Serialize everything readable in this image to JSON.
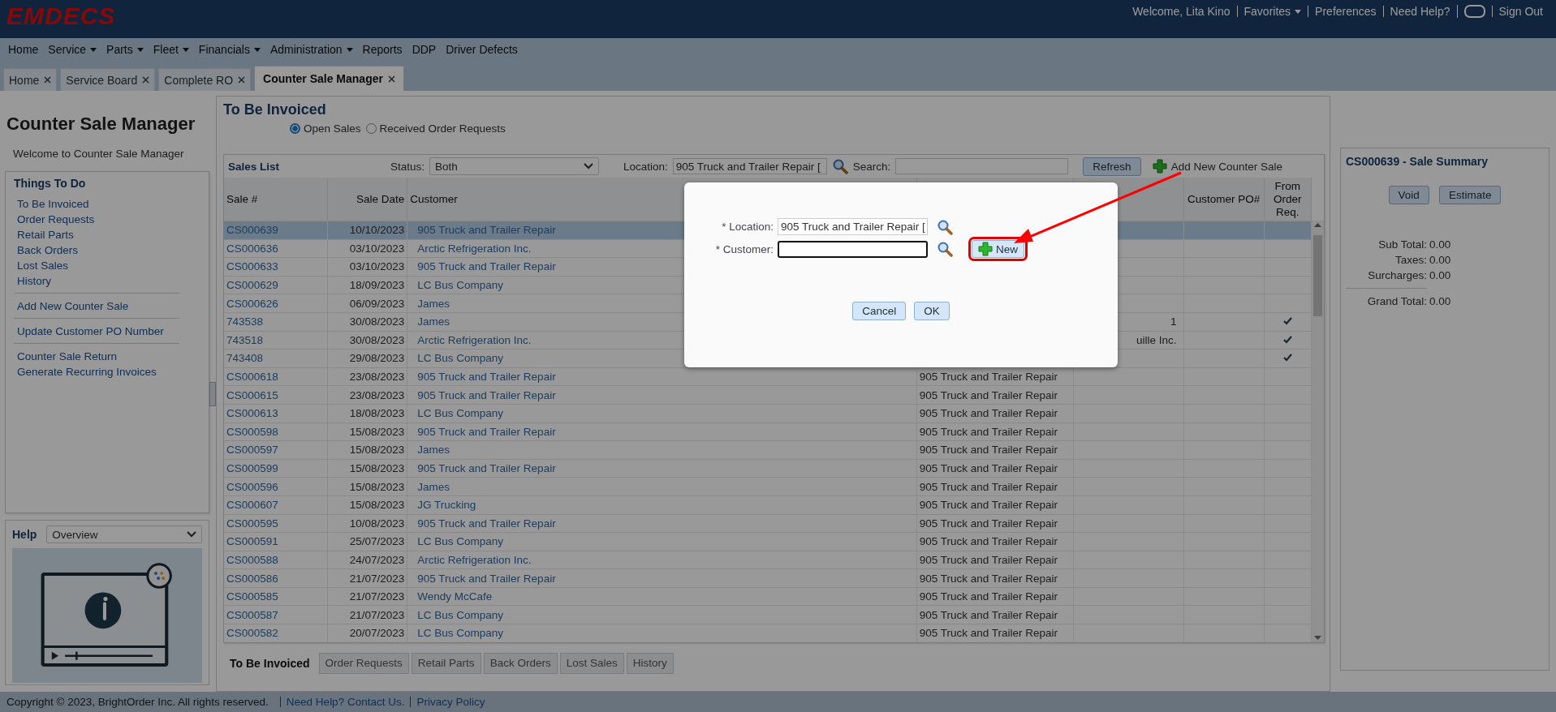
{
  "app": {
    "logo": "EMDECS"
  },
  "user_menu": [
    {
      "kind": "text",
      "label": "Welcome, Lita Kino"
    },
    {
      "kind": "dropdown",
      "label": "Favorites"
    },
    {
      "kind": "link",
      "label": "Preferences"
    },
    {
      "kind": "link",
      "label": "Need Help?"
    },
    {
      "kind": "icon"
    },
    {
      "kind": "link",
      "label": "Sign Out"
    }
  ],
  "main_menu": [
    {
      "label": "Home",
      "has_menu": false
    },
    {
      "label": "Service",
      "has_menu": true
    },
    {
      "label": "Parts",
      "has_menu": true
    },
    {
      "label": "Fleet",
      "has_menu": true
    },
    {
      "label": "Financials",
      "has_menu": true
    },
    {
      "label": "Administration",
      "has_menu": true
    },
    {
      "label": "Reports",
      "has_menu": false
    },
    {
      "label": "DDP",
      "has_menu": false
    },
    {
      "label": "Driver Defects",
      "has_menu": false
    }
  ],
  "page_tabs": [
    {
      "label": "Home",
      "selected": false
    },
    {
      "label": "Service Board",
      "selected": false
    },
    {
      "label": "Complete RO",
      "selected": false
    },
    {
      "label": "Counter Sale Manager",
      "selected": true
    }
  ],
  "sidebar": {
    "title": "Counter Sale Manager",
    "welcome": "Welcome to Counter Sale Manager",
    "things_to_do": {
      "title": "Things To Do",
      "groups": [
        [
          "To Be Invoiced",
          "Order Requests",
          "Retail Parts",
          "Back Orders",
          "Lost Sales",
          "History"
        ],
        [
          "Add New Counter Sale"
        ],
        [
          "Update Customer PO Number"
        ],
        [
          "Counter Sale Return",
          "Generate Recurring Invoices"
        ]
      ]
    },
    "help": {
      "label": "Help",
      "topic": "Overview"
    }
  },
  "content": {
    "title": "To Be Invoiced",
    "view_options": [
      {
        "label": "Open Sales",
        "selected": true
      },
      {
        "label": "Received Order Requests",
        "selected": false
      }
    ],
    "sales_list": {
      "title": "Sales List",
      "status_label": "Status:",
      "status": "Both",
      "location_label": "Location:",
      "location": "905 Truck and Trailer Repair [",
      "search_label": "Search:",
      "refresh": "Refresh",
      "add_new": "Add New Counter Sale",
      "columns": [
        {
          "label": "Sale #",
          "kind": "link"
        },
        {
          "label": "Sale Date",
          "kind": "date"
        },
        {
          "label": "Customer",
          "kind": "link"
        },
        {
          "kind": "text"
        },
        {
          "kind": "text"
        },
        {
          "label": "Customer PO#",
          "kind": "text"
        },
        {
          "label": "From Order Req.",
          "kind": "check"
        }
      ],
      "rows": [
        {
          "sale": "CS000639",
          "date": "10/10/2023",
          "customer": "905 Truck and Trailer Repair",
          "from_order": false,
          "selected": true
        },
        {
          "sale": "CS000636",
          "date": "03/10/2023",
          "customer": "Arctic Refrigeration Inc.",
          "from_order": false,
          "selected": false
        },
        {
          "sale": "CS000633",
          "date": "03/10/2023",
          "customer": "905 Truck and Trailer Repair",
          "from_order": false,
          "selected": false
        },
        {
          "sale": "CS000629",
          "date": "18/09/2023",
          "customer": "LC Bus Company",
          "from_order": false,
          "selected": false
        },
        {
          "sale": "CS000626",
          "date": "06/09/2023",
          "customer": "James",
          "from_order": false,
          "selected": false
        },
        {
          "sale": "743538",
          "date": "30/08/2023",
          "customer": "James",
          "column_5": "1",
          "from_order": true,
          "selected": false
        },
        {
          "sale": "743518",
          "date": "30/08/2023",
          "customer": "Arctic Refrigeration Inc.",
          "column_5": "uille Inc.",
          "from_order": true,
          "selected": false
        },
        {
          "sale": "743408",
          "date": "29/08/2023",
          "customer": "LC Bus Company",
          "from_order": true,
          "selected": false
        },
        {
          "sale": "CS000618",
          "date": "23/08/2023",
          "customer": "905 Truck and Trailer Repair",
          "column_4": "905 Truck and Trailer Repair",
          "from_order": false,
          "selected": false
        },
        {
          "sale": "CS000615",
          "date": "23/08/2023",
          "customer": "905 Truck and Trailer Repair",
          "column_4": "905 Truck and Trailer Repair",
          "from_order": false,
          "selected": false
        },
        {
          "sale": "CS000613",
          "date": "18/08/2023",
          "customer": "LC Bus Company",
          "column_4": "905 Truck and Trailer Repair",
          "from_order": false,
          "selected": false
        },
        {
          "sale": "CS000598",
          "date": "15/08/2023",
          "customer": "905 Truck and Trailer Repair",
          "column_4": "905 Truck and Trailer Repair",
          "from_order": false,
          "selected": false
        },
        {
          "sale": "CS000597",
          "date": "15/08/2023",
          "customer": "James",
          "column_4": "905 Truck and Trailer Repair",
          "from_order": false,
          "selected": false
        },
        {
          "sale": "CS000599",
          "date": "15/08/2023",
          "customer": "905 Truck and Trailer Repair",
          "column_4": "905 Truck and Trailer Repair",
          "from_order": false,
          "selected": false
        },
        {
          "sale": "CS000596",
          "date": "15/08/2023",
          "customer": "James",
          "column_4": "905 Truck and Trailer Repair",
          "from_order": false,
          "selected": false
        },
        {
          "sale": "CS000607",
          "date": "15/08/2023",
          "customer": "JG Trucking",
          "column_4": "905 Truck and Trailer Repair",
          "from_order": false,
          "selected": false
        },
        {
          "sale": "CS000595",
          "date": "10/08/2023",
          "customer": "905 Truck and Trailer Repair",
          "column_4": "905 Truck and Trailer Repair",
          "from_order": false,
          "selected": false
        },
        {
          "sale": "CS000591",
          "date": "25/07/2023",
          "customer": "LC Bus Company",
          "column_4": "905 Truck and Trailer Repair",
          "from_order": false,
          "selected": false
        },
        {
          "sale": "CS000588",
          "date": "24/07/2023",
          "customer": "Arctic Refrigeration Inc.",
          "column_4": "905 Truck and Trailer Repair",
          "from_order": false,
          "selected": false
        },
        {
          "sale": "CS000586",
          "date": "21/07/2023",
          "customer": "905 Truck and Trailer Repair",
          "column_4": "905 Truck and Trailer Repair",
          "from_order": false,
          "selected": false
        },
        {
          "sale": "CS000585",
          "date": "21/07/2023",
          "customer": "Wendy McCafe",
          "column_4": "905 Truck and Trailer Repair",
          "from_order": false,
          "selected": false
        },
        {
          "sale": "CS000587",
          "date": "21/07/2023",
          "customer": "LC Bus Company",
          "column_4": "905 Truck and Trailer Repair",
          "from_order": false,
          "selected": false
        },
        {
          "sale": "CS000582",
          "date": "20/07/2023",
          "customer": "LC Bus Company",
          "column_4": "905 Truck and Trailer Repair",
          "from_order": false,
          "selected": false
        }
      ]
    },
    "bottom_tabs": [
      {
        "label": "To Be Invoiced",
        "selected": true
      },
      {
        "label": "Order Requests",
        "selected": false
      },
      {
        "label": "Retail Parts",
        "selected": false
      },
      {
        "label": "Back Orders",
        "selected": false
      },
      {
        "label": "Lost Sales",
        "selected": false
      },
      {
        "label": "History",
        "selected": false
      }
    ]
  },
  "summary": {
    "title": "CS000639 - Sale Summary",
    "buttons": [
      "Void",
      "Estimate"
    ],
    "totals": [
      {
        "label": "Sub Total:",
        "value": "0.00",
        "kind": "line"
      },
      {
        "label": "Taxes:",
        "value": "0.00",
        "kind": "line"
      },
      {
        "label": "Surcharges:",
        "value": "0.00",
        "kind": "line"
      },
      {
        "label": "Grand Total:",
        "value": "0.00",
        "kind": "grand"
      }
    ]
  },
  "dialog": {
    "fields": [
      {
        "label": "* Location:",
        "value": "905 Truck and Trailer Repair [",
        "focused": false
      },
      {
        "label": "* Customer:",
        "focused": true,
        "new_button": {
          "label": "New",
          "highlighted": true
        }
      }
    ],
    "buttons": [
      "Cancel",
      "OK"
    ]
  },
  "footer": {
    "copyright": "Copyright © 2023, BrightOrder Inc. All rights reserved.",
    "links": [
      "Need Help? Contact Us.",
      "Privacy Policy"
    ]
  }
}
